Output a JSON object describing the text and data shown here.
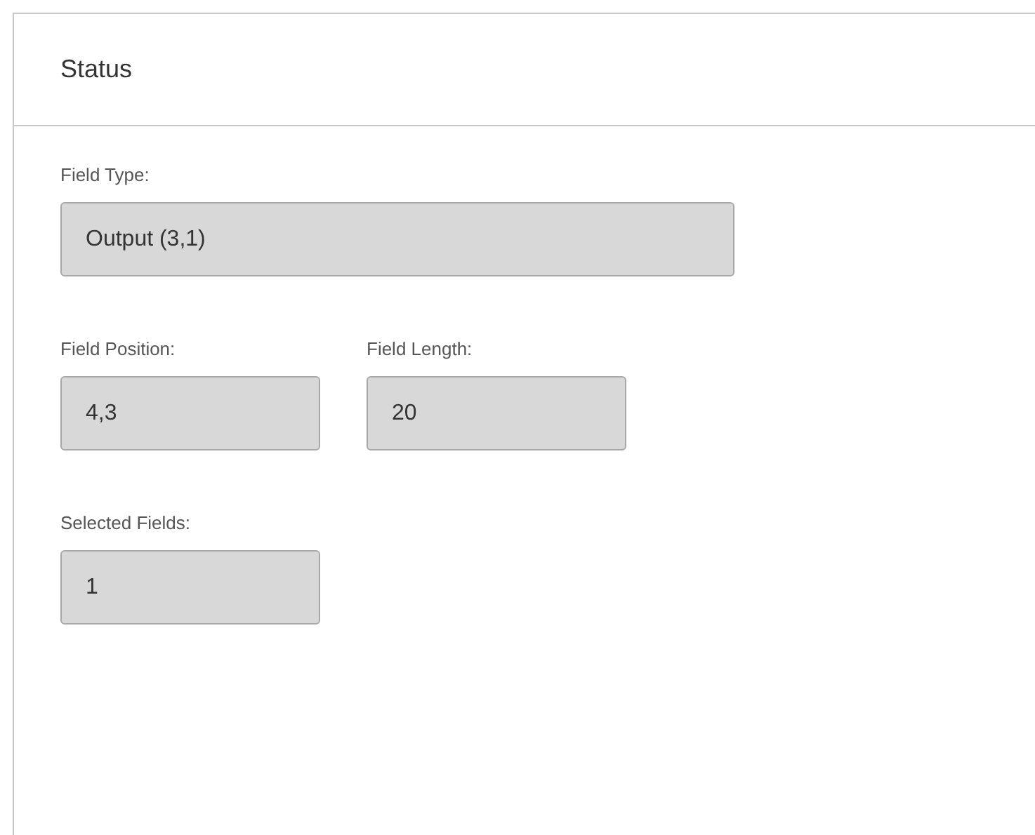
{
  "panel": {
    "title": "Status"
  },
  "rows": [
    [
      {
        "kind": "wide",
        "label": "Field Type:",
        "value": "Output (3,1)"
      }
    ],
    [
      {
        "kind": "narrow",
        "label": "Field Position:",
        "value": "4,3"
      },
      {
        "kind": "narrow",
        "label": "Field Length:",
        "value": "20"
      }
    ],
    [
      {
        "kind": "narrow",
        "label": "Selected Fields:",
        "value": "1"
      }
    ]
  ]
}
